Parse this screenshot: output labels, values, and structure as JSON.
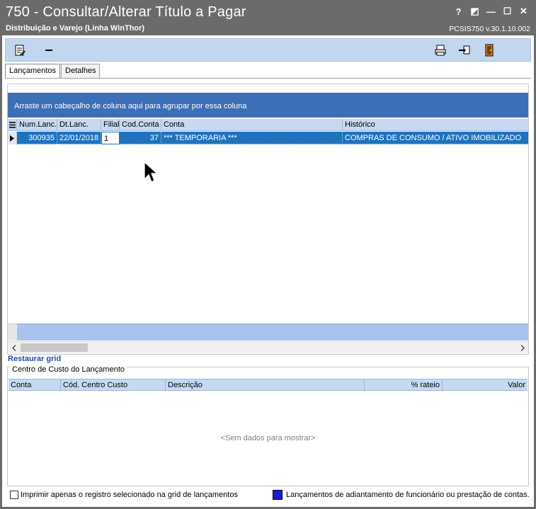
{
  "window": {
    "title": "750 - Consultar/Alterar Título a Pagar",
    "subtitle": "Distribuição e Varejo (Linha WinThor)",
    "version": "PCSIS750  v.30.1.10.002",
    "buttons": {
      "help": "?",
      "restore_small": "◩",
      "minimize": "—",
      "maximize": "☐",
      "close": "✕"
    }
  },
  "toolbar": {
    "icons": [
      "edit-document-icon",
      "minus-icon",
      "print-icon",
      "pointer-hand-icon",
      "exit-door-icon"
    ]
  },
  "tabs": [
    {
      "label": "Lançamentos",
      "active": true
    },
    {
      "label": "Detalhes",
      "active": false
    }
  ],
  "grid": {
    "group_hint": "Arraste um cabeçalho de coluna aqui para agrupar por essa coluna",
    "columns": [
      "Num.Lanc.",
      "Dt.Lanc.",
      "Filial",
      "Cod.Conta",
      "Conta",
      "Histórico"
    ],
    "rows": [
      {
        "num_lanc": "300935",
        "dt_lanc": "22/01/2018",
        "filial": "1",
        "cod_conta": "37",
        "conta": "*** TEMPORARIA ***",
        "historico": "COMPRAS DE CONSUMO / ATIVO IMOBILIZADO"
      }
    ],
    "restore_label": "Restaurar grid"
  },
  "cost_center": {
    "legend": "Centro de Custo do Lançamento",
    "columns": [
      "Conta",
      "Cód. Centro Custo",
      "Descrição",
      "% rateio",
      "Valor"
    ],
    "empty_text": "<Sem dados para mostrar>"
  },
  "bottom": {
    "checkbox_label": "Imprimir apenas o registro selecionado na grid de lançamentos",
    "checkbox_checked": false,
    "legend_label": "Lançamentos de adiantamento de funcionário ou prestação de contas.",
    "legend_color": "#1c1cd6"
  },
  "colors": {
    "titlebar": "#6b6b6b",
    "toolbar": "#c2d6ef",
    "group_bar": "#3d6fb7",
    "selected_row": "#1e73be",
    "grid_header": "#c6d8f2"
  }
}
